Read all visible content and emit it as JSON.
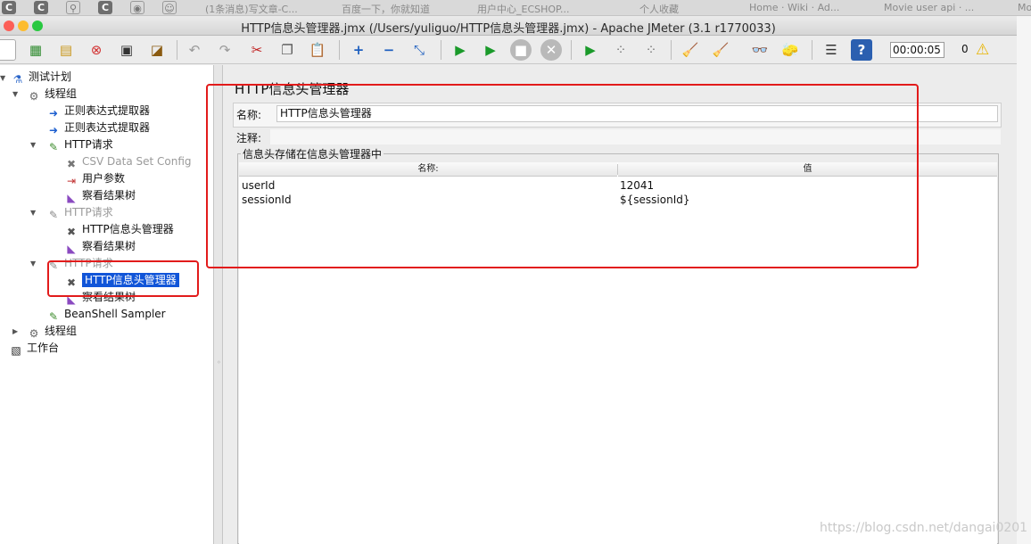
{
  "browser_tabs": [
    {
      "label": "(1条消息)写文章-C..."
    },
    {
      "label": "百度一下，你就知道"
    },
    {
      "label": "用户中心_ECSHOP..."
    },
    {
      "label": "个人收藏"
    },
    {
      "label": "Home · Wiki · Ad..."
    },
    {
      "label": "Movie user api · ..."
    },
    {
      "label": "Mo"
    }
  ],
  "window": {
    "title": "HTTP信息头管理器.jmx (/Users/yuliguo/HTTP信息头管理器.jmx) - Apache JMeter (3.1 r1770033)"
  },
  "toolbar": {
    "elapsed_time": "00:00:05",
    "error_count": "0",
    "buttons": [
      "new-icon",
      "templates-icon",
      "open-icon",
      "close-icon",
      "save-icon",
      "save-as-icon",
      "undo-icon",
      "redo-icon",
      "cut-icon",
      "copy-icon",
      "paste-icon",
      "expand-icon",
      "collapse-icon",
      "toggle-icon",
      "start-icon",
      "start-no-timers-icon",
      "stop-icon",
      "shutdown-icon",
      "remote-start-icon",
      "remote-stop-icon",
      "remote-shutdown-icon",
      "clear-icon",
      "clear-all-icon",
      "search-icon",
      "reset-search-icon",
      "function-helper-icon",
      "help-icon"
    ]
  },
  "tree": {
    "nodes": [
      {
        "label": "测试计划",
        "icon": "flask-icon"
      },
      {
        "label": "线程组",
        "icon": "gear-icon"
      },
      {
        "label": "正则表达式提取器",
        "icon": "extractor-icon"
      },
      {
        "label": "正则表达式提取器",
        "icon": "extractor-icon"
      },
      {
        "label": "HTTP请求",
        "icon": "pipette-icon"
      },
      {
        "label": "CSV Data Set Config",
        "icon": "wrench-icon"
      },
      {
        "label": "用户参数",
        "icon": "preprocessor-icon"
      },
      {
        "label": "察看结果树",
        "icon": "chart-icon"
      },
      {
        "label": "HTTP请求",
        "icon": "pipette-icon"
      },
      {
        "label": "HTTP信息头管理器",
        "icon": "wrench-icon"
      },
      {
        "label": "察看结果树",
        "icon": "chart-icon"
      },
      {
        "label": "HTTP请求",
        "icon": "pipette-icon"
      },
      {
        "label": "HTTP信息头管理器",
        "icon": "wrench-icon"
      },
      {
        "label": "察看结果树",
        "icon": "chart-icon"
      },
      {
        "label": "BeanShell Sampler",
        "icon": "pipette-icon"
      },
      {
        "label": "线程组",
        "icon": "gear-icon"
      },
      {
        "label": "工作台",
        "icon": "workbench-icon"
      }
    ]
  },
  "panel": {
    "title": "HTTP信息头管理器",
    "name_label": "名称:",
    "name_value": "HTTP信息头管理器",
    "comment_label": "注释:",
    "headers_group_title": "信息头存储在信息头管理器中",
    "columns": [
      "名称:",
      "值"
    ],
    "rows": [
      {
        "name": "userId",
        "value": "12041"
      },
      {
        "name": "sessionId",
        "value": "${sessionId}"
      }
    ]
  },
  "watermark": "https://blog.csdn.net/dangai0201",
  "colors": {
    "selection": "#1155d8",
    "annotation_red": "#e21b1b",
    "close_dot": "#fc5f57",
    "minimize_dot": "#fdbc2e",
    "zoom_dot": "#28c840"
  }
}
